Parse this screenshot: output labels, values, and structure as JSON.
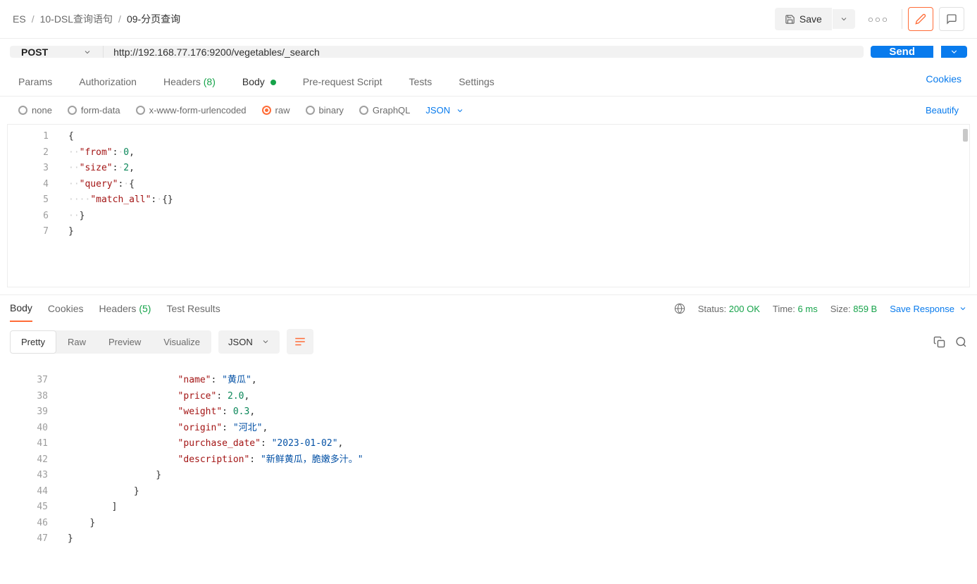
{
  "breadcrumb": {
    "root": "ES",
    "mid": "10-DSL查询语句",
    "current": "09-分页查询"
  },
  "topbar": {
    "save": "Save"
  },
  "request": {
    "method": "POST",
    "url": "http://192.168.77.176:9200/vegetables/_search",
    "send": "Send"
  },
  "reqTabs": {
    "params": "Params",
    "auth": "Authorization",
    "headers": "Headers",
    "headersCount": "(8)",
    "body": "Body",
    "prereq": "Pre-request Script",
    "tests": "Tests",
    "settings": "Settings",
    "cookies": "Cookies"
  },
  "bodyOpts": {
    "none": "none",
    "formdata": "form-data",
    "urlenc": "x-www-form-urlencoded",
    "raw": "raw",
    "binary": "binary",
    "graphql": "GraphQL",
    "jsonLabel": "JSON",
    "beautify": "Beautify"
  },
  "reqBody": {
    "lines": [
      "1",
      "2",
      "3",
      "4",
      "5",
      "6",
      "7"
    ],
    "l1": "{",
    "l2_k": "\"from\"",
    "l2_v": "0",
    "l3_k": "\"size\"",
    "l3_v": "2",
    "l4_k": "\"query\"",
    "l5_k": "\"match_all\"",
    "l6": "}",
    "l7": "}"
  },
  "respTabs": {
    "body": "Body",
    "cookies": "Cookies",
    "headers": "Headers",
    "headersCount": "(5)",
    "results": "Test Results"
  },
  "respMeta": {
    "statusLabel": "Status:",
    "statusVal": "200 OK",
    "timeLabel": "Time:",
    "timeVal": "6 ms",
    "sizeLabel": "Size:",
    "sizeVal": "859 B",
    "saveResp": "Save Response"
  },
  "respView": {
    "pretty": "Pretty",
    "raw": "Raw",
    "preview": "Preview",
    "visualize": "Visualize",
    "json": "JSON"
  },
  "respBody": {
    "lines": [
      "37",
      "38",
      "39",
      "40",
      "41",
      "42",
      "43",
      "44",
      "45",
      "46",
      "47"
    ],
    "name_k": "\"name\"",
    "name_v": "\"黄瓜\"",
    "price_k": "\"price\"",
    "price_v": "2.0",
    "weight_k": "\"weight\"",
    "weight_v": "0.3",
    "origin_k": "\"origin\"",
    "origin_v": "\"河北\"",
    "pd_k": "\"purchase_date\"",
    "pd_v": "\"2023-01-02\"",
    "desc_k": "\"description\"",
    "desc_v": "\"新鲜黄瓜，脆嫩多汁。\""
  }
}
